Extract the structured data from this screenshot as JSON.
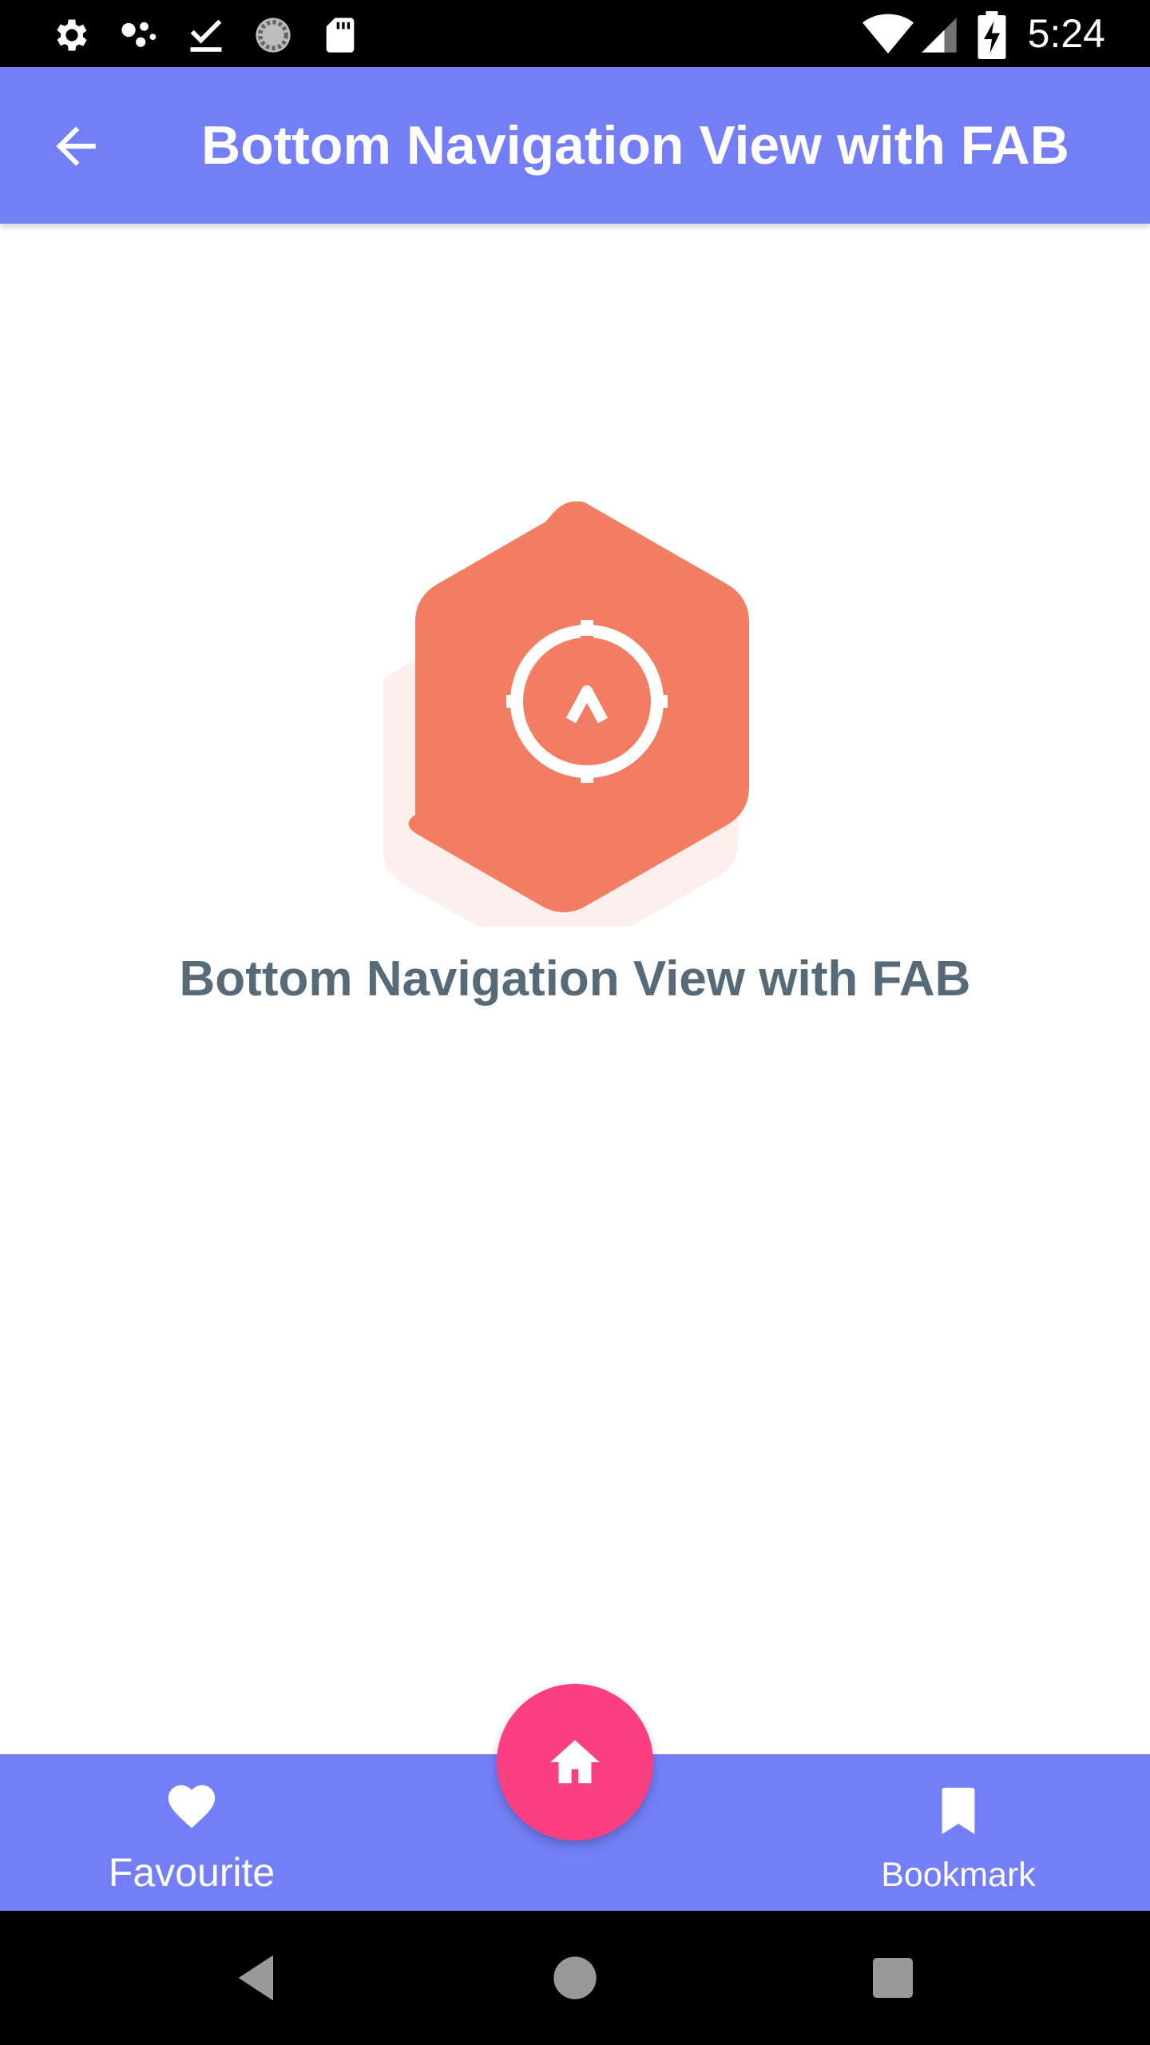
{
  "status_bar": {
    "time": "5:24",
    "icons": [
      "settings-icon",
      "assistant-dots-icon",
      "download-done-icon",
      "loading-circle-icon",
      "sd-card-icon",
      "wifi-icon",
      "signal-icon",
      "battery-charging-icon"
    ]
  },
  "app_bar": {
    "title": "Bottom Navigation View with FAB",
    "back_icon": "arrow-back-icon",
    "color": "#737ef7"
  },
  "content": {
    "title": "Bottom Navigation View with FAB",
    "hero_icon": "compass-hexagon-icon",
    "hero_color": "#f37d62",
    "title_color": "#566a77"
  },
  "bottom_nav": {
    "color": "#737ef7",
    "items": [
      {
        "label": "Favourite",
        "icon": "heart-icon"
      },
      {
        "label": "Bookmark",
        "icon": "bookmark-icon"
      }
    ]
  },
  "fab": {
    "icon": "home-icon",
    "color": "#fb3f80"
  },
  "system_nav": {
    "buttons": [
      "back-triangle-icon",
      "home-circle-icon",
      "recents-square-icon"
    ]
  }
}
